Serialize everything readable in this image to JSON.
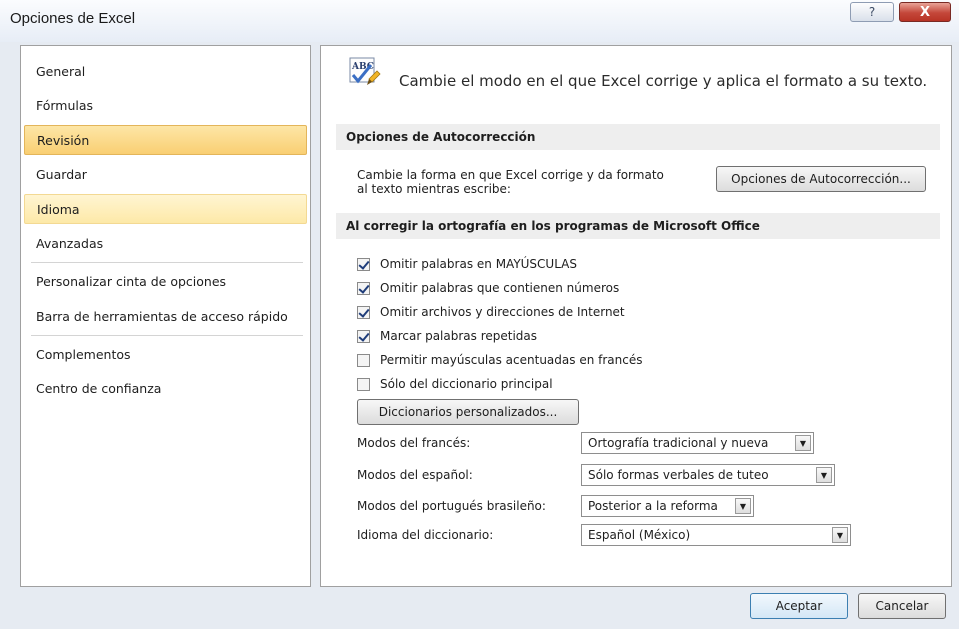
{
  "window": {
    "title": "Opciones de Excel",
    "help_label": "?",
    "close_label": "X"
  },
  "sidebar": {
    "items": [
      {
        "label": "General"
      },
      {
        "label": "Fórmulas"
      },
      {
        "label": "Revisión"
      },
      {
        "label": "Guardar"
      },
      {
        "label": "Idioma"
      },
      {
        "label": "Avanzadas"
      },
      {
        "label": "Personalizar cinta de opciones"
      },
      {
        "label": "Barra de herramientas de acceso rápido"
      },
      {
        "label": "Complementos"
      },
      {
        "label": "Centro de confianza"
      }
    ],
    "selected": "Revisión"
  },
  "main": {
    "header": "Cambie el modo en el que Excel corrige y aplica el formato a su texto.",
    "autocorrect": {
      "section_title": "Opciones de Autocorrección",
      "description_line1": "Cambie la forma en que Excel corrige y da formato",
      "description_line2": "al texto mientras escribe:",
      "button_label": "Opciones de Autocorrección..."
    },
    "spelling": {
      "section_title": "Al corregir la ortografía en los programas de Microsoft Office",
      "checkboxes": [
        {
          "label": "Omitir palabras en MAYÚSCULAS",
          "checked": true
        },
        {
          "label": "Omitir palabras que contienen números",
          "checked": true
        },
        {
          "label": "Omitir archivos y direcciones de Internet",
          "checked": true
        },
        {
          "label": "Marcar palabras repetidas",
          "checked": true
        },
        {
          "label": "Permitir mayúsculas acentuadas en francés",
          "checked": false
        },
        {
          "label": "Sólo del diccionario principal",
          "checked": false
        }
      ],
      "custom_dict_button": "Diccionarios personalizados...",
      "modes": [
        {
          "label": "Modos del francés:",
          "value": "Ortografía tradicional y nueva"
        },
        {
          "label": "Modos del español:",
          "value": "Sólo formas verbales de tuteo"
        },
        {
          "label": "Modos del portugués brasileño:",
          "value": "Posterior a la reforma"
        },
        {
          "label": "Idioma del diccionario:",
          "value": "Español (México)"
        }
      ]
    }
  },
  "footer": {
    "ok_label": "Aceptar",
    "cancel_label": "Cancelar"
  },
  "colors": {
    "selected_nav": "#f9cf73",
    "section_bar": "#eeeeee",
    "close_button": "#c4473a"
  }
}
